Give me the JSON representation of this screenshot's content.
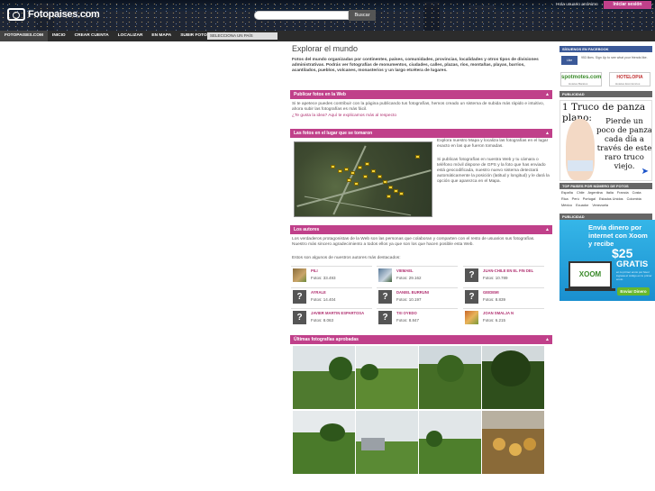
{
  "header": {
    "logo_text": "Fotopaises.com",
    "search_placeholder": "",
    "search_button": "Buscar",
    "greeting": "Hola usuario anónimo",
    "login_button": "Iniciar sesión"
  },
  "nav": {
    "items": [
      "FOTOPAISES.COM",
      "INICIO",
      "CREAR CUENTA",
      "LOCALIZAR",
      "EN MAPA",
      "SUBIR FOTOS",
      "MÁS"
    ],
    "country_select": "SELECCIONA UN PAÍS"
  },
  "main": {
    "title": "Explorar el mundo",
    "intro": "Fotos del mundo organizadas por continentes, países, comunidades, provincias, localidades y otros tipos de divisiones administrativas. Podrás ver fotografías de monumentos, ciudades, calles, plazas, ríos, montañas, playas, barrios, acantilados, pueblos, volcanes, monasterios y un largo etcétera de lugares.",
    "publish": {
      "bar": "Publicar fotos en la Web",
      "text": "Si te apetece puedes contribuir con la página publicando tus fotografías, hemos creado un sistema de subida más rápido e intuitivo, ahora subir las fotografías es más fácil.",
      "link": "¿Te gusta la idea? Aquí te explicamos más al respecto"
    },
    "map_section": {
      "bar": "Las fotos en el lugar que se tomaron",
      "text1": "Explora nuestro Mapa y localiza las fotografías en el lugar exacto en las que fueron tomadas.",
      "text2": "Si publicas fotografías en nuestra Web y tu cámara o teléfono móvil dispone de GPS y la foto que has enviado está geocodificada, nuestro nuevo sistema detectará automáticamente la posición (latitud y longitud) y le dará la opción que aparezca en el Mapa."
    },
    "authors_section": {
      "bar": "Los autores",
      "text": "Los verdaderos protagonistas de la Web son las personas que colaboran y comparten con el resto de usuarios sus fotografías. Nuestro más sincero agradecimiento a todos ellos ya que son los que hacen posible esta Web.",
      "subtitle": "Estos son algunos de nuestros autores más destacados:",
      "authors": [
        {
          "name": "PILI",
          "fotos": "Fotos: 33.493",
          "photo": true
        },
        {
          "name": "VIEMAEL",
          "fotos": "Fotos: 29.162",
          "photo": true
        },
        {
          "name": "JUAN-CHILE EN EL FIN DEL",
          "fotos": "Fotos: 10.789",
          "photo": false
        },
        {
          "name": "AYRALE",
          "fotos": "Fotos: 14.404",
          "photo": false
        },
        {
          "name": "DANIEL BURRUNI",
          "fotos": "Fotos: 10.197",
          "photo": false
        },
        {
          "name": "GEIDEMI",
          "fotos": "Fotos: 8.839",
          "photo": false
        },
        {
          "name": "JAVIER MARTIN ESPARTOSA",
          "fotos": "Fotos: 8.063",
          "photo": false
        },
        {
          "name": "TXI OYEDO",
          "fotos": "Fotos: 8.847",
          "photo": false
        },
        {
          "name": "JOAN SMALJA N",
          "fotos": "Fotos: 6.215",
          "photo": true
        }
      ],
      "fotos_label": "Fotos:"
    },
    "latest": {
      "bar": "Últimas fotografías aprobadas"
    },
    "toggle": "▲"
  },
  "sidebar": {
    "fb_bar": "SÍGUENOS EN FACEBOOK",
    "fb_text": "953 likes. Sign Up to see what your friends like.",
    "fb_button": "Like",
    "ad1": "spotmotes.com",
    "ad1_sub": "Hoteles Baratos",
    "ad2": "HOTELOPIA",
    "ad2_sub": "Hoteles Económicos",
    "pub_bar": "PUBLICIDAD",
    "truco_title": "1 Truco de panza plano:",
    "truco_body": "Pierde un poco de panza cada día a través de este raro truco viejo.",
    "countries_bar": "TOP PAISES POR NÚMERO DE FOTOS",
    "countries": [
      "España",
      "Chile",
      "Argentina",
      "Italia",
      "Francia",
      "Costa Rica",
      "Perú",
      "Portugal",
      "Estados Unidos",
      "Colombia",
      "México",
      "Ecuador",
      "Venezuela"
    ],
    "pub_bar2": "PUBLICIDAD",
    "xoom_title": "Envía dinero por internet con Xoom y recibe",
    "xoom_big": "$25",
    "xoom_gratis": "GRATIS",
    "xoom_small": "en tu primer envío por favor ingresa el código en tu primer envío",
    "xoom_logo": "XOOM",
    "xoom_button": "Enviar Dinero"
  },
  "colors": {
    "accent": "#c0408a",
    "nav_bg": "#2c2c2c",
    "facebook": "#3b5998"
  }
}
